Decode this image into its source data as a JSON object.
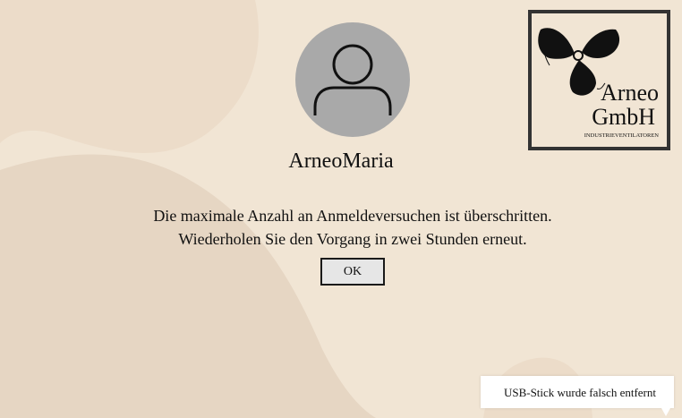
{
  "colors": {
    "background": "#f1e5d4",
    "background_shape": "#e6d6c3",
    "avatar": "#a9a9a9",
    "button_background": "#e6e6e6",
    "logo_frame": "#333333"
  },
  "user": {
    "name": "ArneoMaria",
    "avatar_icon": "user-silhouette-icon"
  },
  "message": {
    "line1": "Die maximale Anzahl an Anmeldeversuchen ist überschritten.",
    "line2": "Wiederholen Sie den Vorgang in zwei Stunden erneut."
  },
  "ok_button": {
    "label": "OK"
  },
  "logo": {
    "line1": "Arneo",
    "line2": "GmbH",
    "tagline": "INDUSTRIEVENTILATOREN",
    "icon": "fan-propeller-icon"
  },
  "notification": {
    "text": "USB-Stick wurde falsch entfernt"
  }
}
